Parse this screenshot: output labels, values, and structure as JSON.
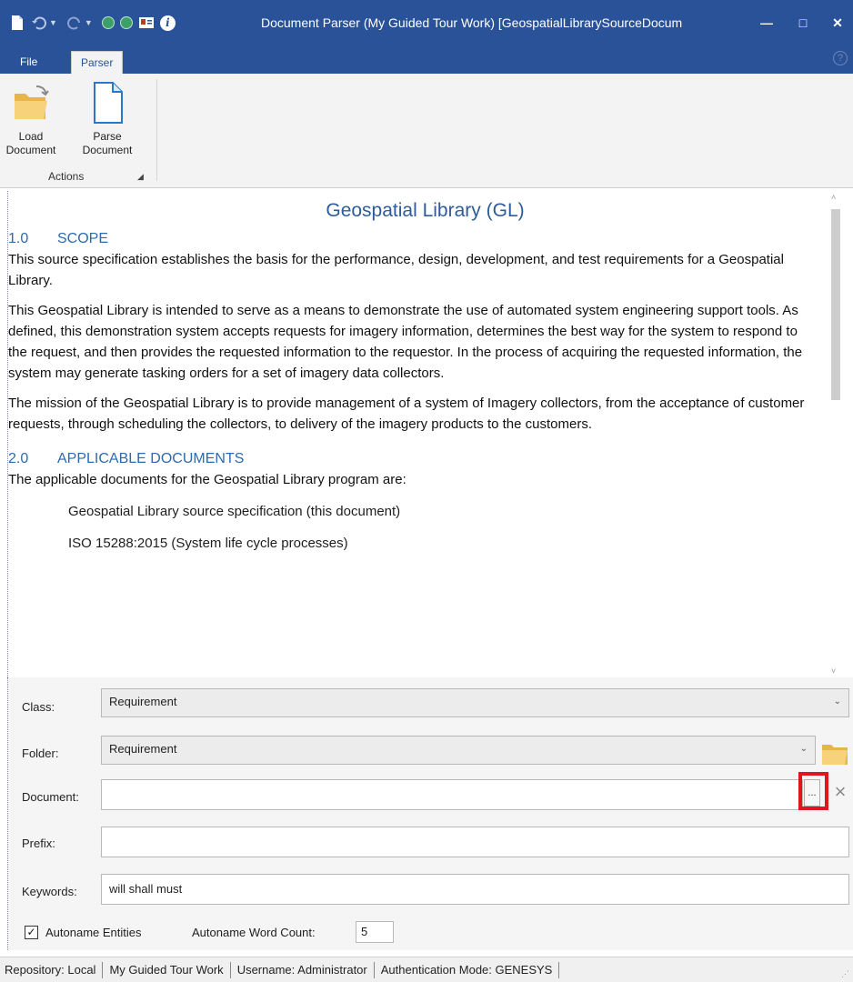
{
  "window": {
    "title": "Document Parser (My Guided Tour Work) [GeospatialLibrarySourceDocum",
    "minimize": "—",
    "maximize": "□",
    "close": "✕"
  },
  "ribbon": {
    "tabs": [
      {
        "label": "File"
      },
      {
        "label": "Parser"
      }
    ],
    "help": "?",
    "buttons": [
      {
        "line1": "Load",
        "line2": "Document",
        "icon": "folder-open-icon"
      },
      {
        "line1": "Parse",
        "line2": "Document",
        "icon": "document-icon"
      }
    ],
    "group_label": "Actions"
  },
  "document": {
    "title": "Geospatial Library (GL)",
    "sections": [
      {
        "num": "1.0",
        "heading": "SCOPE"
      },
      {
        "num": "2.0",
        "heading": "APPLICABLE DOCUMENTS"
      }
    ],
    "p1": "This source specification establishes the basis for the performance, design, development, and test requirements for a Geospatial Library.",
    "p2": "This Geospatial Library is intended to serve as a means to demonstrate the use of automated system engineering support tools.  As defined, this demonstration system accepts requests for imagery information, determines the best way for the system to respond to the request, and then provides the requested information to the requestor.  In the process of acquiring the requested information, the system may generate tasking orders for a set of imagery data collectors.",
    "p3": "The mission of the Geospatial Library is to provide management of a system of Imagery collectors, from the acceptance of customer requests, through scheduling the collectors, to delivery of the imagery products to the customers.",
    "p4": "The applicable documents for the Geospatial Library program are:",
    "items": [
      "Geospatial Library source specification (this document)",
      "ISO 15288:2015 (System life cycle processes)"
    ]
  },
  "form": {
    "class_label": "Class:",
    "class_value": "Requirement",
    "folder_label": "Folder:",
    "folder_value": "Requirement",
    "document_label": "Document:",
    "document_value": "",
    "browse_label": "...",
    "clear_label": "×",
    "prefix_label": "Prefix:",
    "prefix_value": "",
    "keywords_label": "Keywords:",
    "keywords_value": "will shall must",
    "autoname_label": "Autoname Entities",
    "autoname_checked": "✓",
    "wordcount_label": "Autoname Word Count:",
    "wordcount_value": "5"
  },
  "status": {
    "repository": "Repository: Local",
    "project": "My Guided Tour Work",
    "username": "Username: Administrator",
    "auth": "Authentication Mode: GENESYS"
  },
  "colors": {
    "titlebar": "#2a5298",
    "heading": "#2e6aaf",
    "highlight": "#e0161f"
  }
}
